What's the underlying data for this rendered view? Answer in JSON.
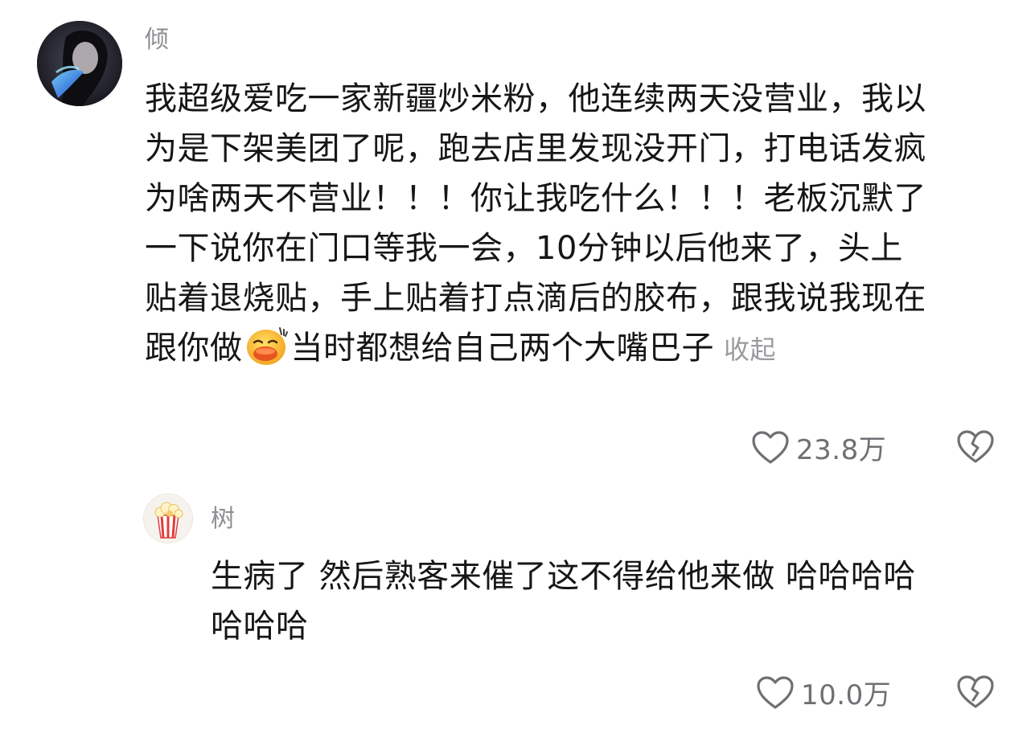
{
  "comments": [
    {
      "username": "倾",
      "lines": [
        "我超级爱吃一家新疆炒米粉，他连续两天没营业，我以",
        "为是下架美团了呢，跑去店里发现没开门，打电话发疯",
        "为啥两天不营业！！！你让我吃什么！！！老板沉默了",
        "一下说你在门口等我一会，10分钟以后他来了，头上",
        "贴着退烧贴，手上贴着打点滴后的胶布，跟我说我现在"
      ],
      "last_line_before_emoji": "跟你做",
      "last_line_after_emoji": "当时都想给自己两个大嘴巴子",
      "collapse_label": "收起",
      "like_count": "23.8万",
      "inline_emoji": "grinning-face-sweat-emoji"
    },
    {
      "username": "树",
      "lines": [
        "生病了 然后熟客来催了这不得给他来做 哈哈哈哈",
        "哈哈哈"
      ],
      "like_count": "10.0万",
      "avatar_icon": "popcorn-icon"
    }
  ],
  "colors": {
    "text": "#161616",
    "username": "#8e8e93",
    "muted": "#6f6f74",
    "background": "#ffffff"
  },
  "icons": {
    "like": "heart-outline-icon",
    "dislike": "broken-heart-icon"
  }
}
